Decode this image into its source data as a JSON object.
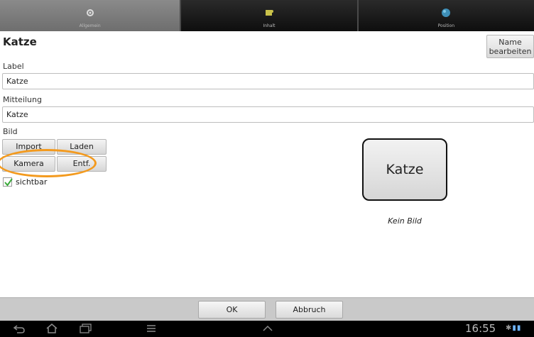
{
  "tabs": [
    {
      "label": "Allgemein",
      "icon": "gear-icon",
      "state": "active"
    },
    {
      "label": "Inhalt",
      "icon": "puzzle-icon",
      "state": "inactive"
    },
    {
      "label": "Position",
      "icon": "globe-icon",
      "state": "inactive"
    }
  ],
  "header": {
    "title": "Katze",
    "rename_button": "Name bearbeiten"
  },
  "form": {
    "label_caption": "Label",
    "label_value": "Katze",
    "message_caption": "Mitteilung",
    "message_value": "Katze",
    "image_caption": "Bild"
  },
  "image_buttons": {
    "import": "Import",
    "load": "Laden",
    "camera": "Kamera",
    "remove": "Entf."
  },
  "visible_checkbox": {
    "label": "sichtbar",
    "checked": true
  },
  "preview": {
    "text": "Katze",
    "caption": "Kein Bild"
  },
  "dialog_buttons": {
    "ok": "OK",
    "cancel": "Abbruch"
  },
  "status_bar": {
    "time": "16:55"
  },
  "colors": {
    "highlight_ring": "#f39a1e",
    "checkmark": "#3aa83a"
  }
}
